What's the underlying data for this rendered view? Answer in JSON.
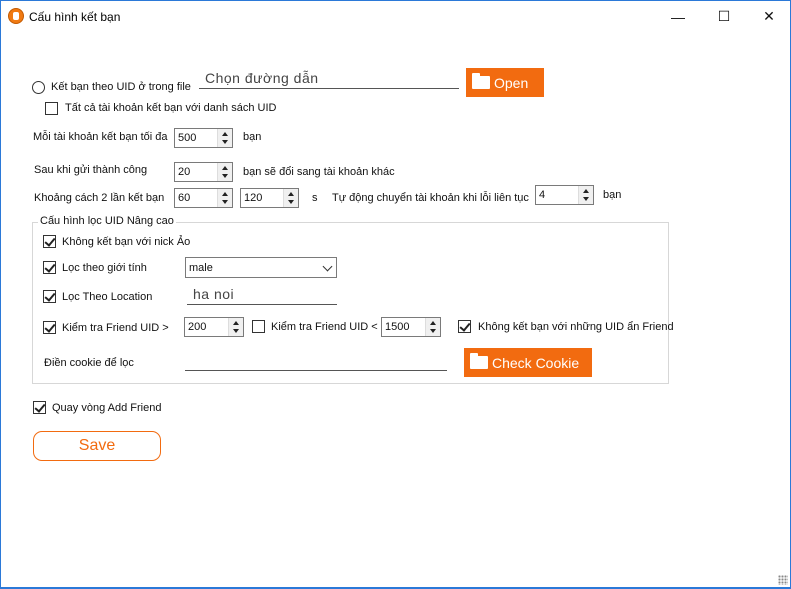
{
  "window": {
    "title": "Cấu hình kết bạn",
    "minimize": "—",
    "maximize": "☐",
    "close": "✕"
  },
  "file_option": {
    "label": "Kết bạn theo UID ở trong file",
    "path_placeholder": "Chọn đường dẫn",
    "open_button": "Open",
    "all_accounts_label": "Tất cả tài khoản kết bạn với danh sách UID"
  },
  "max_per_account": {
    "label": "Mỗi tài khoản kết bạn tối đa",
    "value": "500",
    "unit": "bạn"
  },
  "after_sent": {
    "label": "Sau khi gửi thành công",
    "value": "20",
    "suffix": "bạn sẽ đổi sang tài khoản khác"
  },
  "interval": {
    "label": "Khoảng cách 2 lần kết bạn",
    "min": "60",
    "max": "120",
    "unit": "s",
    "auto_switch_label": "Tự động chuyển tài khoản khi lỗi liên tục",
    "auto_switch_value": "4",
    "auto_switch_unit": "bạn"
  },
  "advanced": {
    "title": "Cấu hình lọc UID Nâng cao",
    "no_fake_label": "Không kết bạn với nick Ảo",
    "gender_label": "Lọc theo giới tính",
    "gender_value": "male",
    "location_label": "Lọc Theo Location",
    "location_value": "ha noi",
    "friend_min_label": "Kiểm tra Friend UID >",
    "friend_min_value": "200",
    "friend_max_label": "Kiểm tra Friend UID <",
    "friend_max_value": "1500",
    "hidden_friend_label": "Không kết bạn với những UID ẩn Friend",
    "cookie_label": "Điền cookie để lọc",
    "check_cookie_button": "Check Cookie"
  },
  "loop_label": "Quay vòng Add Friend",
  "save_button": "Save",
  "colors": {
    "accent": "#f26b10",
    "window_border": "#2b79d8"
  }
}
